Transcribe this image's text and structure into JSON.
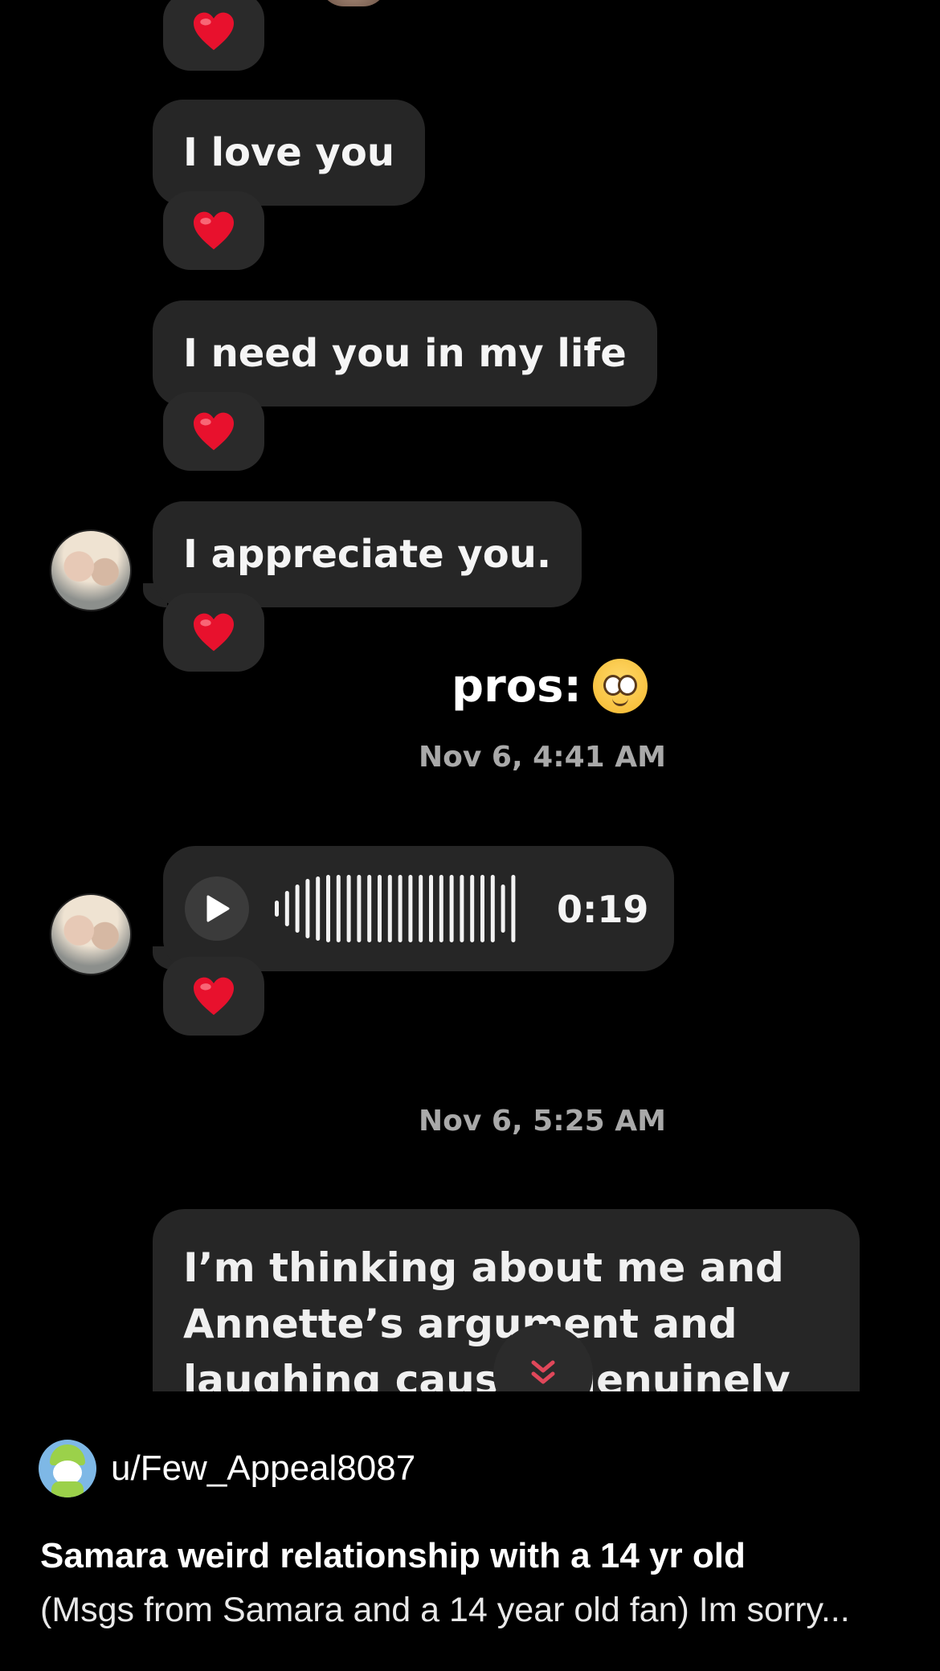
{
  "chat": {
    "messages": [
      {
        "text": "I love you",
        "reaction": "❤️"
      },
      {
        "text": "I need you in my life",
        "reaction": "❤️"
      },
      {
        "text": "I appreciate you.",
        "reaction": "❤️"
      }
    ],
    "first_reaction": "❤️",
    "outgoing_text": "pros:",
    "outgoing_emoji": "pleading-face",
    "timestamp_1": "Nov 6, 4:41 AM",
    "voice_message": {
      "duration": "0:19",
      "reaction": "❤️"
    },
    "timestamp_2": "Nov 6, 5:25 AM",
    "long_message": {
      "line1": "I’m thinking about me and",
      "line2": "Annette’s argument and",
      "line3": "laughing cause i genuinely so"
    }
  },
  "post": {
    "username": "u/Few_Appeal8087",
    "title": "Samara weird relationship with a 14 yr old",
    "body": "(Msgs from Samara and a 14 year old fan) Im sorry..."
  },
  "colors": {
    "background": "#000000",
    "bubble": "#262626",
    "heart": "#e8112d",
    "timestamp": "#a9a9a9",
    "scroll_chevron": "#e0475a"
  }
}
